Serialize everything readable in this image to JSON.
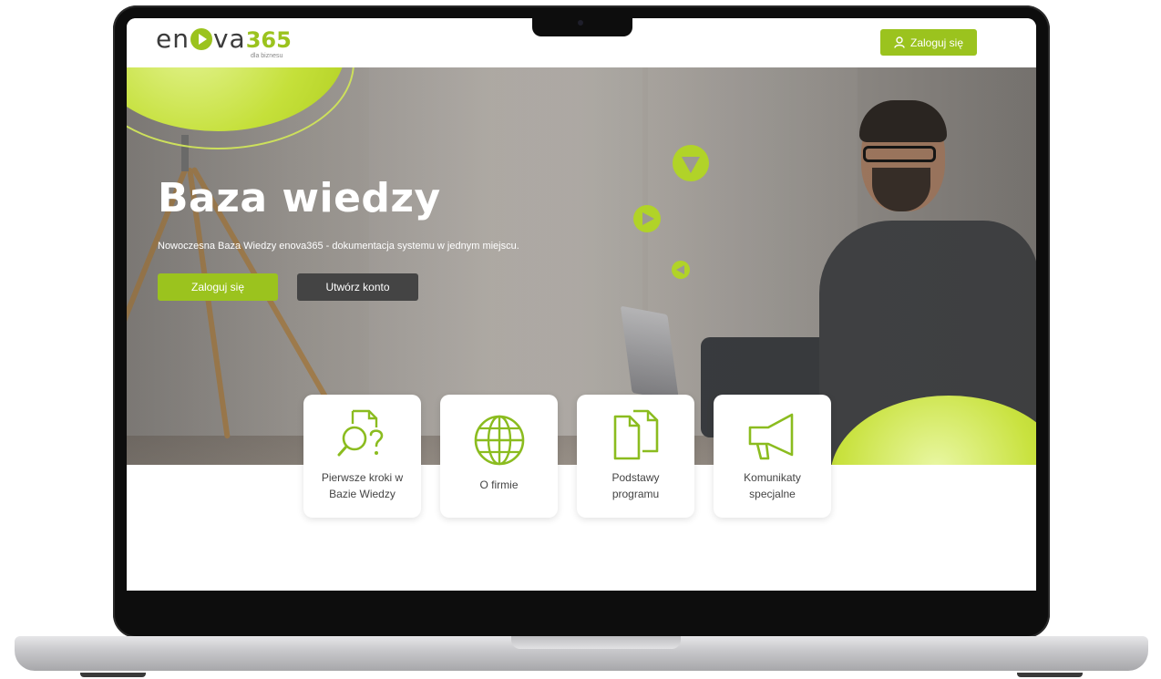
{
  "header": {
    "logo_text": "enova",
    "logo_number": "365",
    "logo_tagline": "dla biznesu",
    "login_label": "Zaloguj się"
  },
  "hero": {
    "title": "Baza wiedzy",
    "subtitle": "Nowoczesna Baza Wiedzy enova365 - dokumentacja systemu w jednym miejscu.",
    "login_label": "Zaloguj się",
    "create_label": "Utwórz konto"
  },
  "cards": [
    {
      "label": "Pierwsze kroki w\nBazie Wiedzy",
      "icon": "search-document-icon"
    },
    {
      "label": "O firmie",
      "icon": "globe-icon"
    },
    {
      "label": "Podstawy\nprogramu",
      "icon": "documents-icon"
    },
    {
      "label": "Komunikaty\nspecjalne",
      "icon": "megaphone-icon"
    }
  ],
  "colors": {
    "accent": "#9bc31e",
    "dark_button": "#444444",
    "laptop_frame": "#0d0d0d"
  }
}
